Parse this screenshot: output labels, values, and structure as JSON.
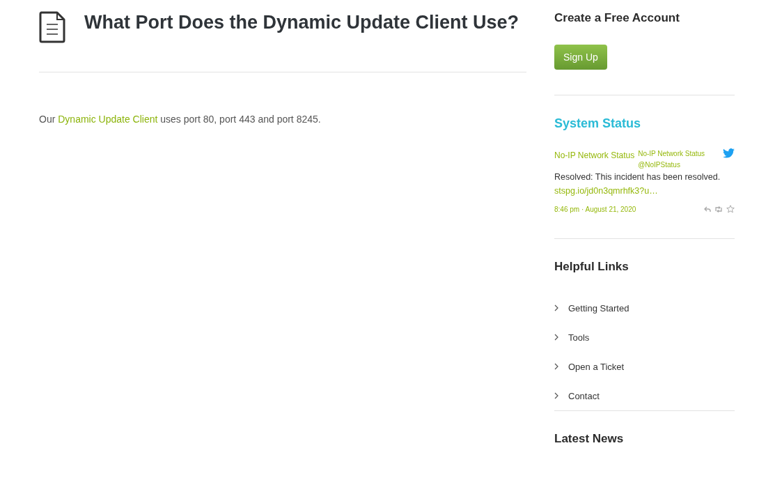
{
  "article": {
    "title": "What Port Does the Dynamic Update Client Use?",
    "body": {
      "before": "Our ",
      "link": "Dynamic Update Client",
      "after": " uses port 80, port 443 and port 8245."
    }
  },
  "sidebar": {
    "account": {
      "heading": "Create a Free Account",
      "button": "Sign Up"
    },
    "status": {
      "heading": "System Status",
      "tweet": {
        "source": "No-IP Network Status",
        "account_name": "No-IP Network Status",
        "handle": "@NoIPStatus",
        "text": "Resolved: This incident has been resolved.",
        "link": "stspg.io/jd0n3qmrhfk3?u…",
        "time": "8:46 pm · August 21, 2020"
      }
    },
    "links": {
      "heading": "Helpful Links",
      "items": [
        "Getting Started",
        "Tools",
        "Open a Ticket",
        "Contact"
      ]
    },
    "news": {
      "heading": "Latest News"
    }
  }
}
